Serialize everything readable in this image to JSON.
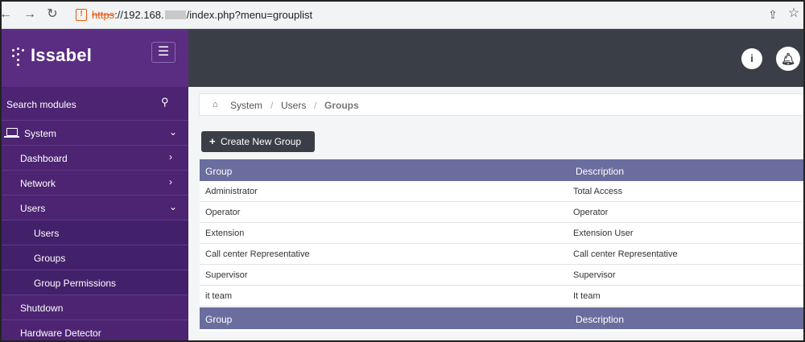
{
  "browser": {
    "url_protocol": "https",
    "url_host": "://192.168.",
    "url_path": "/index.php?menu=grouplist",
    "back_icon": "arrow-left-icon",
    "forward_icon": "arrow-right-icon",
    "reload_icon": "reload-icon",
    "share_icon": "share-icon",
    "bookmark_icon": "star-icon"
  },
  "brand": {
    "name": "Issabel"
  },
  "sidebar": {
    "search_label": "Search modules",
    "items": [
      {
        "label": "System",
        "chevron": "⌄"
      },
      {
        "label": "Dashboard",
        "chevron": "›"
      },
      {
        "label": "Network",
        "chevron": "›"
      },
      {
        "label": "Users",
        "chevron": "⌄"
      },
      {
        "label": "Users"
      },
      {
        "label": "Groups"
      },
      {
        "label": "Group Permissions"
      },
      {
        "label": "Shutdown"
      },
      {
        "label": "Hardware Detector"
      }
    ]
  },
  "breadcrumb": {
    "items": [
      "System",
      "Users",
      "Groups"
    ],
    "separator": "/"
  },
  "actions": {
    "create_label": "Create New Group"
  },
  "table": {
    "columns": [
      "Group",
      "Description"
    ],
    "rows": [
      [
        "Administrator",
        "Total Access"
      ],
      [
        "Operator",
        "Operator"
      ],
      [
        "Extension",
        "Extension User"
      ],
      [
        "Call center Representative",
        "Call center Representative"
      ],
      [
        "Supervisor",
        "Supervisor"
      ],
      [
        "it team",
        "It team"
      ]
    ]
  },
  "colors": {
    "sidebar": "#5b2d82",
    "topbar": "#3a3f47",
    "table_header": "#6a6d9e"
  }
}
